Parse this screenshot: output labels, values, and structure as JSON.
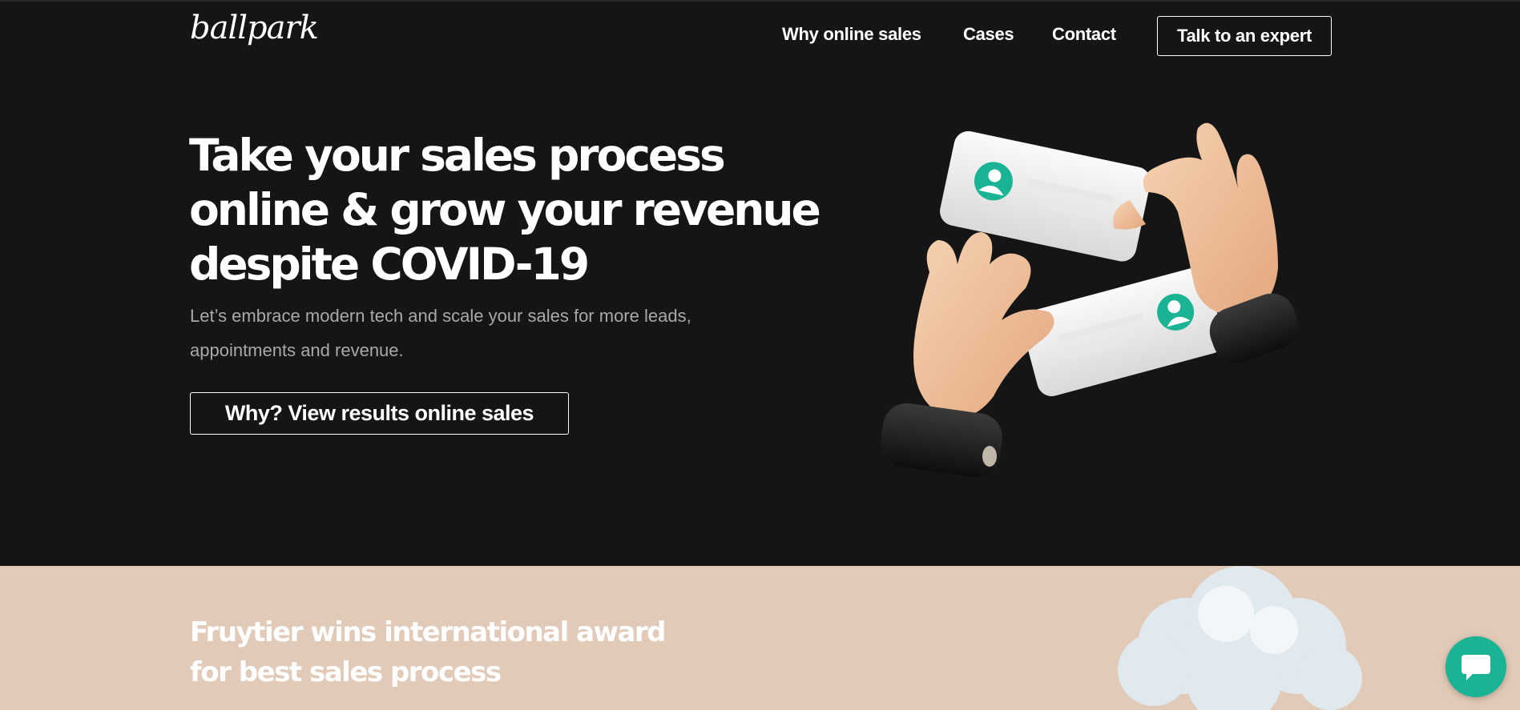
{
  "header": {
    "logo_text": "ballpark",
    "nav": {
      "why_online_sales": "Why online sales",
      "cases": "Cases",
      "contact": "Contact"
    },
    "cta_label": "Talk to an expert"
  },
  "hero": {
    "title_line1": "Take your sales process",
    "title_line2": "online & grow your revenue",
    "title_line3": "despite COVID-19",
    "subtitle_line1": "Let’s embrace modern tech and scale your sales for more leads,",
    "subtitle_line2": "appointments and revenue.",
    "button_label": "Why? View results online sales",
    "illustration_icon": "hands-exchanging-cards-illustration"
  },
  "award": {
    "title_line1": "Fruytier wins international award",
    "title_line2": "for best sales process",
    "decoration_icon": "cloud-icon"
  },
  "chat": {
    "icon": "chat-bubble-icon"
  },
  "colors": {
    "background": "#151515",
    "award_background": "#e2cab9",
    "accent_green": "#1ab394",
    "text_white": "#ffffff",
    "text_muted": "#a9a9a9"
  }
}
